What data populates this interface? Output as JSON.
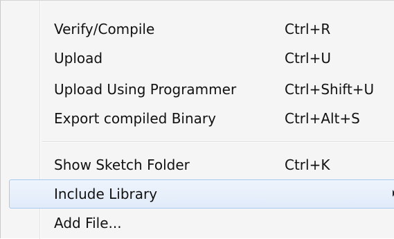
{
  "menu": {
    "items": [
      {
        "label": "Verify/Compile",
        "shortcut": "Ctrl+R"
      },
      {
        "label": "Upload",
        "shortcut": "Ctrl+U"
      },
      {
        "label": "Upload Using Programmer",
        "shortcut": "Ctrl+Shift+U"
      },
      {
        "label": "Export compiled Binary",
        "shortcut": "Ctrl+Alt+S"
      },
      {
        "label": "Show Sketch Folder",
        "shortcut": "Ctrl+K"
      },
      {
        "label": "Include Library",
        "submenu_icon": "submenu-arrow-icon",
        "highlighted": true
      },
      {
        "label": "Add File..."
      }
    ]
  },
  "colors": {
    "menu_background": "#f5f5f5",
    "highlight_border": "#a8c8ef",
    "highlight_fill": "#e6eefa",
    "text": "#111111"
  }
}
